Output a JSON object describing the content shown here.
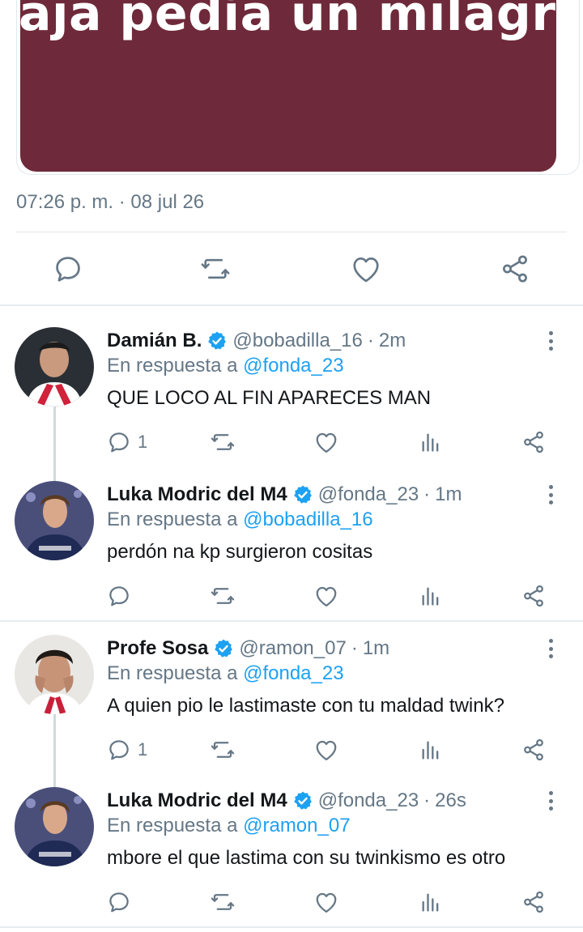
{
  "media": {
    "caption": "aja pedía un milagro",
    "bg_color": "#6e2a3a"
  },
  "main_tweet": {
    "timestamp": "07:26 p. m. · 08 jul 26"
  },
  "replies": [
    {
      "name": "Damián B.",
      "handle": "@bobadilla_16",
      "time": "2m",
      "reply_prefix": "En respuesta a",
      "reply_to": "@fonda_23",
      "text": "QUE LOCO AL FIN APARECES MAN",
      "reply_count": "1"
    },
    {
      "name": "Luka Modric del M4",
      "handle": "@fonda_23",
      "time": "1m",
      "reply_prefix": "En respuesta a",
      "reply_to": "@bobadilla_16",
      "text": "perdón na kp surgieron cositas",
      "reply_count": ""
    },
    {
      "name": "Profe Sosa",
      "handle": "@ramon_07",
      "time": "1m",
      "reply_prefix": "En respuesta a",
      "reply_to": "@fonda_23",
      "text": "A quien pio le lastimaste con tu maldad twink?",
      "reply_count": "1"
    },
    {
      "name": "Luka Modric del M4",
      "handle": "@fonda_23",
      "time": "26s",
      "reply_prefix": "En respuesta a",
      "reply_to": "@ramon_07",
      "text": "mbore el que lastima con su twinkismo es otro",
      "reply_count": ""
    }
  ],
  "colors": {
    "accent": "#1da1f2",
    "muted": "#657786",
    "text": "#14171a"
  }
}
